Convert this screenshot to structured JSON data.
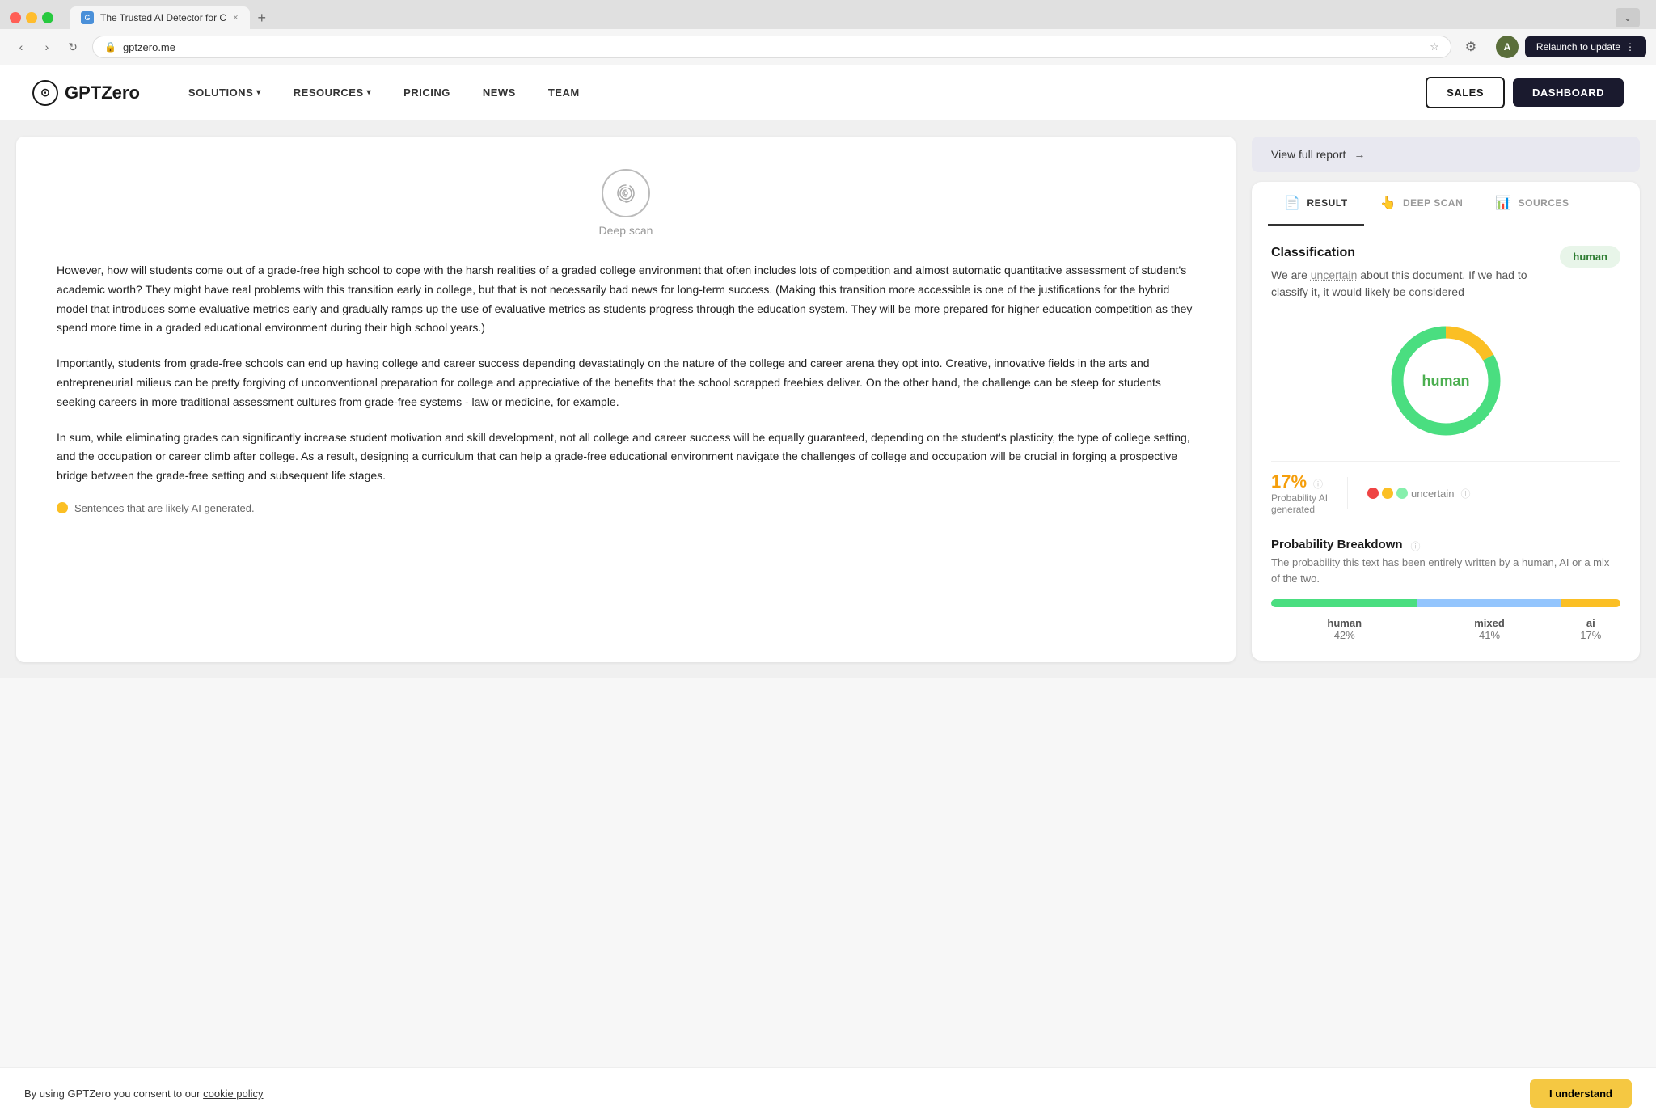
{
  "browser": {
    "tab_title": "The Trusted AI Detector for C",
    "tab_close": "×",
    "new_tab": "+",
    "address": "gptzero.me",
    "relaunch_label": "Relaunch to update",
    "nav_back": "‹",
    "nav_forward": "›",
    "nav_refresh": "↻",
    "profile_initial": "A",
    "chevron_down": "⌄",
    "more_options": "⋮"
  },
  "site_nav": {
    "logo_text": "GPTZero",
    "solutions_label": "SOLUTIONS",
    "resources_label": "RESOURCES",
    "pricing_label": "PRICING",
    "news_label": "NEWS",
    "team_label": "TEAM",
    "sales_label": "SALES",
    "dashboard_label": "DASHBOARD"
  },
  "result_panel": {
    "view_full_report": "View full report",
    "arrow": "→",
    "tabs": [
      {
        "id": "result",
        "label": "RESULT",
        "icon": "📄",
        "active": true
      },
      {
        "id": "deep-scan",
        "label": "DEEP SCAN",
        "icon": "👆",
        "active": false
      },
      {
        "id": "sources",
        "label": "SOURCES",
        "icon": "📊",
        "active": false
      }
    ],
    "classification": {
      "title": "Classification",
      "desc_prefix": "We are ",
      "uncertain_word": "uncertain",
      "desc_suffix": " about this document. If we had to classify it, it would likely be considered",
      "badge": "human"
    },
    "donut": {
      "label": "human",
      "human_pct": 83,
      "ai_pct": 17
    },
    "stats": {
      "ai_pct": "17%",
      "ai_label": "Probability AI",
      "ai_sublabel": "generated",
      "uncertain_label": "uncertain"
    },
    "probability_breakdown": {
      "title": "Probability Breakdown",
      "desc": "The probability this text has been entirely written by a human, AI or a mix of the two.",
      "human_label": "human",
      "human_pct": "42%",
      "human_bar": 42,
      "mixed_label": "mixed",
      "mixed_pct": "41%",
      "mixed_bar": 41,
      "ai_label": "ai",
      "ai_pct": "17%",
      "ai_bar": 17
    }
  },
  "document": {
    "deep_scan_label": "Deep scan",
    "paragraphs": [
      "However, how will students come out of a grade-free high school to cope with the harsh realities of a graded college environment that often includes lots of competition and almost automatic quantitative assessment of student's academic worth? They might have real problems with this transition early in college, but that is not necessarily bad news for long-term success. (Making this transition more accessible is one of the justifications for the hybrid model that introduces some evaluative metrics early and gradually ramps up the use of evaluative metrics as students progress through the education system. They will be more prepared for higher education competition as they spend more time in a graded educational environment during their high school years.)",
      "Importantly, students from grade-free schools can end up having college and career success depending devastatingly on the nature of the college and career arena they opt into. Creative, innovative fields in the arts and entrepreneurial milieus can be pretty forgiving of unconventional preparation for college and appreciative of the benefits that the school scrapped freebies deliver. On the other hand, the challenge can be steep for students seeking careers in more traditional assessment cultures from grade-free systems - law or medicine, for example.",
      "In sum, while eliminating grades can significantly increase student motivation and skill development, not all college and career success will be equally guaranteed, depending on the student's plasticity, the type of college setting, and the occupation or career climb after college. As a result, designing a curriculum that can help a grade-free educational environment navigate the challenges of college and occupation will be crucial in forging a prospective bridge between the grade-free setting and subsequent life stages."
    ],
    "bottom_note": "Sentences that are likely AI generated."
  },
  "cookie_banner": {
    "text": "By using GPTZero you consent to our ",
    "link_text": "cookie policy",
    "accept_label": "I understand"
  }
}
